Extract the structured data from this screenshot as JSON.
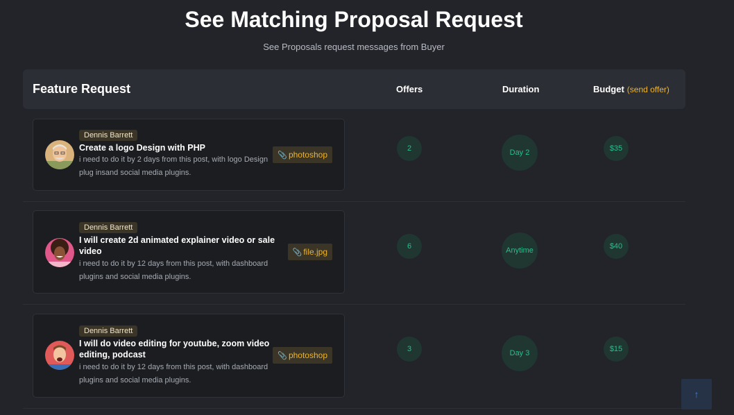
{
  "header": {
    "title": "See Matching Proposal Request",
    "subtitle": "See Proposals request messages from Buyer"
  },
  "table": {
    "columns": {
      "feature": "Feature Request",
      "offers": "Offers",
      "duration": "Duration",
      "budget": "Budget",
      "send_offer": "(send offer)"
    },
    "rows": [
      {
        "buyer": "Dennis Barrett",
        "title": "Create a logo Design with PHP",
        "description": "i need to do it by 2 days from this post, with logo Design plug insand social media plugins.",
        "attachment": "photoshop",
        "offers": "2",
        "duration": "Day 2",
        "budget": "$35"
      },
      {
        "buyer": "Dennis Barrett",
        "title": "I will create 2d animated explainer video or sale video",
        "description": "i need to do it by 12 days from this post, with dashboard plugins and social media plugins.",
        "attachment": "file.jpg",
        "offers": "6",
        "duration": "Anytime",
        "budget": "$40"
      },
      {
        "buyer": "Dennis Barrett",
        "title": "I will do video editing for youtube, zoom video editing, podcast",
        "description": "i need to do it by 12 days from this post, with dashboard plugins and social media plugins.",
        "attachment": "photoshop",
        "offers": "3",
        "duration": "Day 3",
        "budget": "$15"
      }
    ]
  },
  "icons": {
    "attachment": "paperclip-icon",
    "scroll_top": "arrow-up-icon"
  },
  "colors": {
    "background": "#22242a",
    "accent": "#f0b429",
    "status_green": "#24c18c"
  }
}
